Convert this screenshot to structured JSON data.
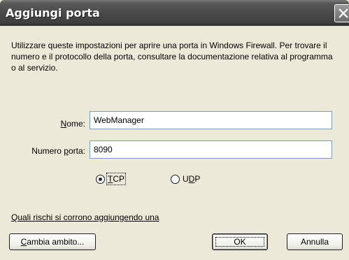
{
  "window": {
    "title": "Aggiungi porta"
  },
  "description": "Utilizzare queste impostazioni per aprire una porta in Windows Firewall. Per trovare il numero e il protocollo della porta, consultare la documentazione relativa al programma o al servizio.",
  "fields": {
    "name_label_prefix": "",
    "name_label_underlined": "N",
    "name_label_rest": "ome:",
    "name_value": "WebManager",
    "port_label_prefix": "Numero ",
    "port_label_underlined": "p",
    "port_label_rest": "orta:",
    "port_value": "8090"
  },
  "protocol": {
    "tcp_label_underlined": "T",
    "tcp_label_rest": "CP",
    "udp_label_prefix": "U",
    "udp_label_underlined": "D",
    "udp_label_rest": "P",
    "selected": "TCP"
  },
  "link": {
    "text": "Quali rischi si corrono aggiungendo una"
  },
  "buttons": {
    "change_scope_underlined": "C",
    "change_scope_rest": "ambia ambito...",
    "ok": "OK",
    "cancel": "Annulla"
  }
}
